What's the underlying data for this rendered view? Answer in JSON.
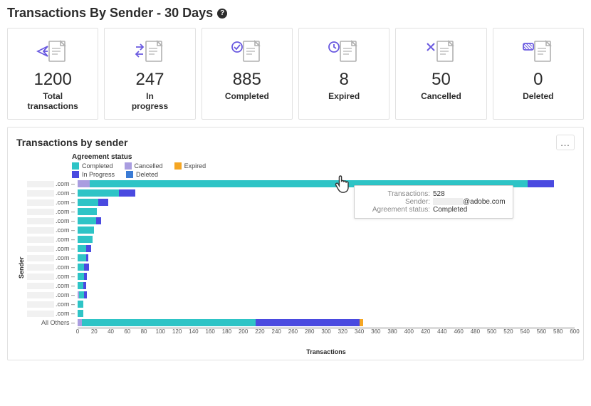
{
  "title": "Transactions By Sender - 30 Days",
  "cards": [
    {
      "label": "Total transactions",
      "value": "1200",
      "icon": "send-doc-icon"
    },
    {
      "label": "In progress",
      "value": "247",
      "icon": "inprogress-doc-icon"
    },
    {
      "label": "Completed",
      "value": "885",
      "icon": "completed-doc-icon"
    },
    {
      "label": "Expired",
      "value": "8",
      "icon": "expired-doc-icon"
    },
    {
      "label": "Cancelled",
      "value": "50",
      "icon": "cancelled-doc-icon"
    },
    {
      "label": "Deleted",
      "value": "0",
      "icon": "deleted-doc-icon"
    }
  ],
  "chart": {
    "title": "Transactions by sender",
    "legend_title": "Agreement status",
    "more_label": "…",
    "xlabel": "Transactions",
    "ylabel": "Sender",
    "x_ticks": [
      0,
      20,
      40,
      60,
      80,
      100,
      120,
      140,
      160,
      180,
      200,
      220,
      240,
      260,
      280,
      300,
      320,
      340,
      360,
      380,
      400,
      420,
      440,
      460,
      480,
      500,
      520,
      540,
      560,
      580,
      600
    ],
    "legend": [
      {
        "name": "Completed",
        "color": "#2ec4c6"
      },
      {
        "name": "Cancelled",
        "color": "#a99de0"
      },
      {
        "name": "Expired",
        "color": "#f5a623"
      },
      {
        "name": "In Progress",
        "color": "#4a4ae0"
      },
      {
        "name": "Deleted",
        "color": "#3a7bd5"
      }
    ]
  },
  "tooltip": {
    "transactions_label": "Transactions:",
    "transactions_value": "528",
    "sender_label": "Sender:",
    "sender_value_suffix": "@adobe.com",
    "status_label": "Agreement status:",
    "status_value": "Completed"
  },
  "colors": {
    "completed": "#2ec4c6",
    "cancelled": "#a99de0",
    "expired": "#f5a623",
    "inprogress": "#4a4ae0",
    "deleted": "#3a7bd5"
  },
  "chart_data": {
    "type": "bar",
    "orientation": "horizontal",
    "stacked": true,
    "xlabel": "Transactions",
    "ylabel": "Sender",
    "xlim": [
      0,
      600
    ],
    "legend_position": "top-left",
    "series_names": [
      "Cancelled",
      "Completed",
      "In Progress",
      "Expired",
      "Deleted"
    ],
    "categories": [
      ".com",
      ".com",
      ".com",
      ".com",
      ".com",
      ".com",
      ".com",
      ".com",
      ".com",
      ".com",
      ".com",
      ".com",
      ".com",
      ".com",
      ".com",
      "All Others"
    ],
    "series": [
      {
        "name": "Cancelled",
        "color": "#a99de0",
        "values": [
          15,
          0,
          0,
          0,
          0,
          0,
          0,
          0,
          0,
          0,
          0,
          0,
          2,
          0,
          0,
          5
        ]
      },
      {
        "name": "Completed",
        "color": "#2ec4c6",
        "values": [
          528,
          50,
          25,
          23,
          22,
          20,
          18,
          10,
          10,
          8,
          8,
          7,
          6,
          7,
          7,
          210
        ]
      },
      {
        "name": "In Progress",
        "color": "#4a4ae0",
        "values": [
          32,
          20,
          12,
          0,
          6,
          0,
          0,
          6,
          3,
          6,
          3,
          3,
          3,
          0,
          0,
          125
        ]
      },
      {
        "name": "Expired",
        "color": "#f5a623",
        "values": [
          0,
          0,
          0,
          0,
          0,
          0,
          0,
          0,
          0,
          0,
          0,
          0,
          0,
          0,
          0,
          5
        ]
      },
      {
        "name": "Deleted",
        "color": "#3a7bd5",
        "values": [
          0,
          0,
          0,
          0,
          0,
          0,
          0,
          0,
          0,
          0,
          0,
          0,
          0,
          0,
          0,
          0
        ]
      }
    ]
  }
}
